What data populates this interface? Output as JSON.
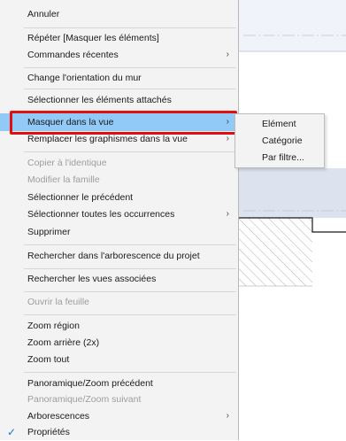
{
  "menu": {
    "items": [
      {
        "label": "Annuler"
      },
      {
        "label": "Répéter [Masquer les éléments]"
      },
      {
        "label": "Commandes récentes"
      },
      {
        "label": "Change l'orientation du mur"
      },
      {
        "label": "Sélectionner les éléments attachés"
      },
      {
        "label": "Masquer dans la vue"
      },
      {
        "label": "Remplacer les graphismes dans la vue"
      },
      {
        "label": "Copier à l'identique"
      },
      {
        "label": "Modifier la famille"
      },
      {
        "label": "Sélectionner le précédent"
      },
      {
        "label": "Sélectionner toutes les occurrences"
      },
      {
        "label": "Supprimer"
      },
      {
        "label": "Rechercher dans l'arborescence du projet"
      },
      {
        "label": "Rechercher les vues associées"
      },
      {
        "label": "Ouvrir la feuille"
      },
      {
        "label": "Zoom région"
      },
      {
        "label": "Zoom arrière (2x)"
      },
      {
        "label": "Zoom tout"
      },
      {
        "label": "Panoramique/Zoom précédent"
      },
      {
        "label": "Panoramique/Zoom suivant"
      },
      {
        "label": "Arborescences"
      },
      {
        "label": "Propriétés"
      }
    ],
    "submenu_arrow": "›",
    "checkmark": "✓",
    "highlight_color": "#91c9f7",
    "annotation_color": "#e01010"
  },
  "submenu": {
    "items": [
      {
        "label": "Elément"
      },
      {
        "label": "Catégorie"
      },
      {
        "label": "Par filtre..."
      }
    ]
  }
}
